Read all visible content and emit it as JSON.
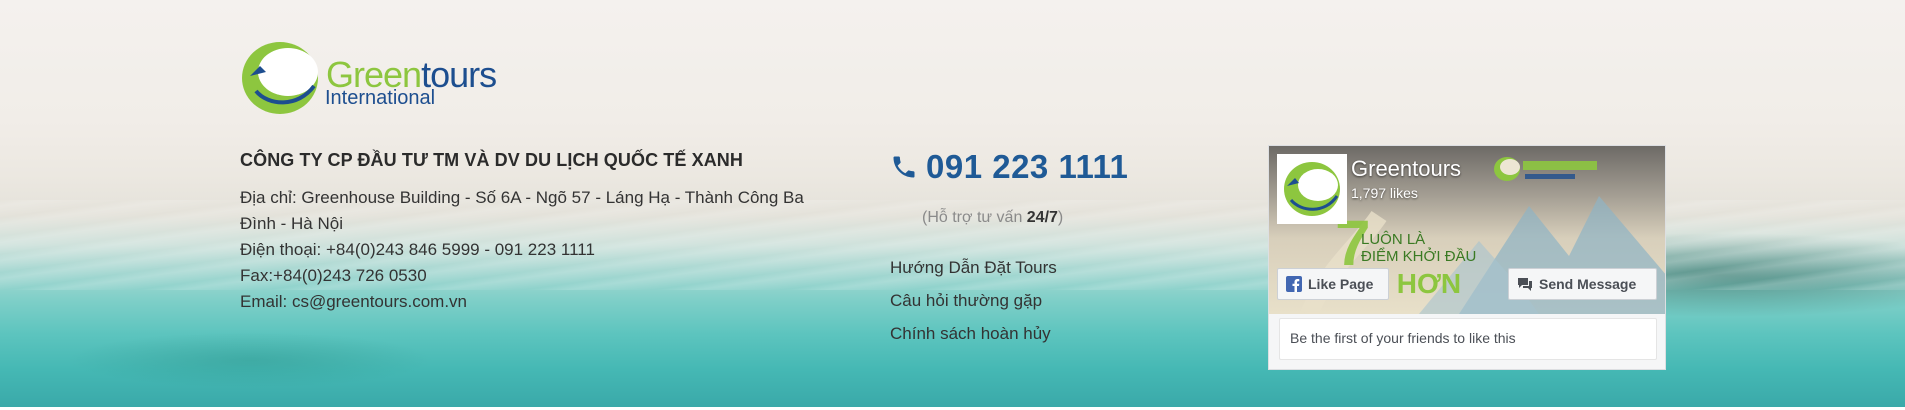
{
  "logo": {
    "part1": "Green",
    "part2": "tours",
    "subtitle": "International",
    "colors": {
      "green": "#8dc63f",
      "blue": "#1d4e8f"
    }
  },
  "company": {
    "name": "CÔNG TY CP ĐẦU TƯ TM VÀ DV DU LỊCH QUỐC TẾ XANH",
    "address_line1": "Địa chỉ: Greenhouse Building - Số 6A - Ngõ 57 - Láng Hạ - Thành Công Ba",
    "address_line2": "Đình - Hà Nội",
    "phone": "Điện thoại: +84(0)243 846 5999 - 091 223 1111",
    "fax": "Fax:+84(0)243 726 0530",
    "email": "Email: cs@greentours.com.vn"
  },
  "contact": {
    "phone_icon": "phone-icon",
    "hotline": "091 223 1111",
    "support_prefix": "(Hỗ trợ tư vấn ",
    "support_hours": "24/7",
    "support_suffix": ")",
    "accent_color": "#1f5a96"
  },
  "links": [
    {
      "label": "Hướng Dẫn Đặt Tours"
    },
    {
      "label": "Câu hỏi thường gặp"
    },
    {
      "label": "Chính sách hoàn hủy"
    }
  ],
  "facebook": {
    "page_name": "Greentours",
    "likes": "1,797 likes",
    "cover_slogan_line1": "LUÔN LÀ",
    "cover_slogan_line2": "ĐIỂM KHỞI ĐẦU",
    "cover_slogan_big": "ẠI HƠN",
    "cover_number": "7",
    "like_button": "Like Page",
    "send_button": "Send Message",
    "friends_text": "Be the first of your friends to like this",
    "icons": {
      "like": "facebook-f-icon",
      "send": "messenger-icon"
    }
  }
}
